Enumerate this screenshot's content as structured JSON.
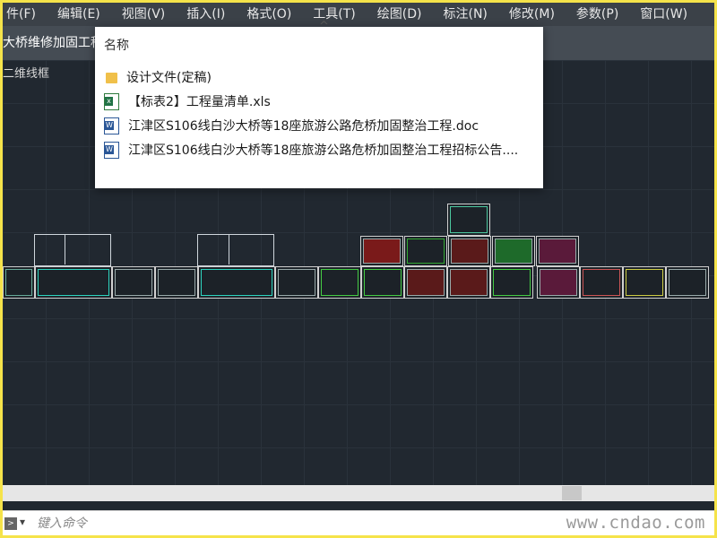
{
  "menu": [
    "件(F)",
    "编辑(E)",
    "视图(V)",
    "插入(I)",
    "格式(O)",
    "工具(T)",
    "绘图(D)",
    "标注(N)",
    "修改(M)",
    "参数(P)",
    "窗口(W)"
  ],
  "tab": {
    "title": "大桥维修加固工程"
  },
  "viewport_label": "二维线框",
  "popup": {
    "header": "名称",
    "files": [
      {
        "name": "设计文件(定稿)",
        "icon": "folder-icon"
      },
      {
        "name": "【标表2】工程量清单.xls",
        "icon": "excel-file-icon"
      },
      {
        "name": "江津区S106线白沙大桥等18座旅游公路危桥加固整治工程.doc",
        "icon": "word-file-icon"
      },
      {
        "name": "江津区S106线白沙大桥等18座旅游公路危桥加固整治工程招标公告....",
        "icon": "word-file-icon"
      }
    ]
  },
  "command": {
    "placeholder": "键入命令"
  },
  "watermark": "www.cndao.com",
  "colors": {
    "canvas": "#212830",
    "menubar": "#3b4148",
    "frame_border": "#f5e34a",
    "sheet_border": "#d0d0d0"
  }
}
